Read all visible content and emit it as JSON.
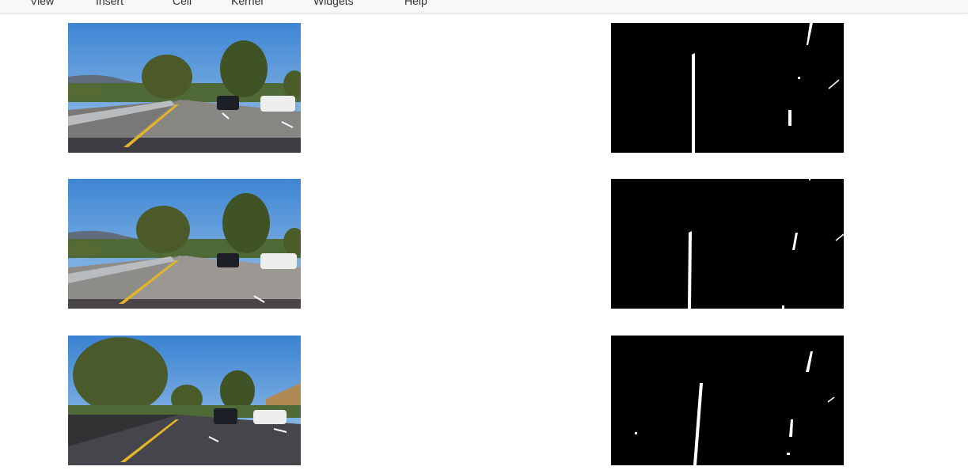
{
  "menu": {
    "items": [
      {
        "label": "View"
      },
      {
        "label": "Insert"
      },
      {
        "label": "Cell"
      },
      {
        "label": "Kernel"
      },
      {
        "label": "Widgets"
      },
      {
        "label": "Help"
      }
    ]
  },
  "output": {
    "rows": [
      {
        "original": "road-photo",
        "binary": "lane-mask"
      },
      {
        "original": "road-photo",
        "binary": "lane-mask"
      },
      {
        "original": "road-photo",
        "binary": "lane-mask"
      }
    ]
  },
  "colors": {
    "sky": "#4f8fd4",
    "road": "#5b5b62",
    "lane_yellow": "#e2b628",
    "mask_bg": "#000000",
    "mask_line": "#ffffff"
  }
}
